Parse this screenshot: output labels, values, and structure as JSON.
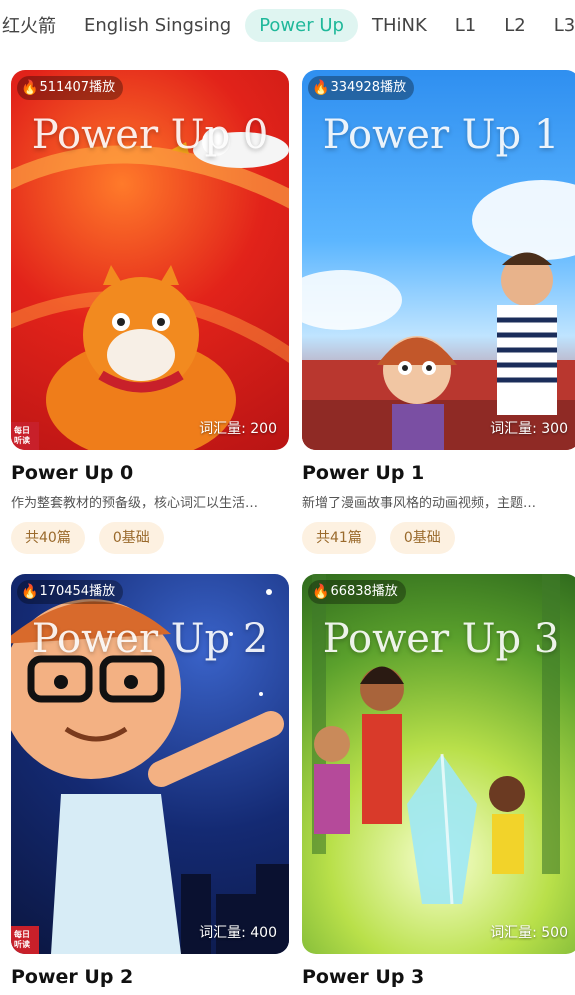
{
  "tabs": [
    {
      "label": "红火箭",
      "active": false
    },
    {
      "label": "English Singsing",
      "active": false
    },
    {
      "label": "Power Up",
      "active": true
    },
    {
      "label": "THiNK",
      "active": false
    },
    {
      "label": "L1",
      "active": false
    },
    {
      "label": "L2",
      "active": false
    },
    {
      "label": "L3",
      "active": false
    }
  ],
  "cards": [
    {
      "thumb_title": "Power Up 0",
      "plays": "511407播放",
      "vocab": "词汇量: 200",
      "title": "Power Up 0",
      "desc": "作为整套教材的预备级，核心词汇以生活…",
      "chips": [
        "共40篇",
        "0基础"
      ],
      "scene_color": "#e2231a"
    },
    {
      "thumb_title": "Power Up 1",
      "plays": "334928播放",
      "vocab": "词汇量: 300",
      "title": "Power Up 1",
      "desc": "新增了漫画故事风格的动画视频，主题…",
      "chips": [
        "共41篇",
        "0基础"
      ],
      "scene_color": "#5cb6ff"
    },
    {
      "thumb_title": "Power Up 2",
      "plays": "170454播放",
      "vocab": "词汇量: 400",
      "title": "Power Up 2",
      "desc": "",
      "chips": [],
      "scene_color": "#142a73"
    },
    {
      "thumb_title": "Power Up 3",
      "plays": "66838播放",
      "vocab": "词汇量: 500",
      "title": "Power Up 3",
      "desc": "",
      "chips": [],
      "scene_color": "#b9e04a"
    }
  ],
  "corner_badge": "每日听读",
  "icons": {
    "plays": "fire-icon"
  }
}
